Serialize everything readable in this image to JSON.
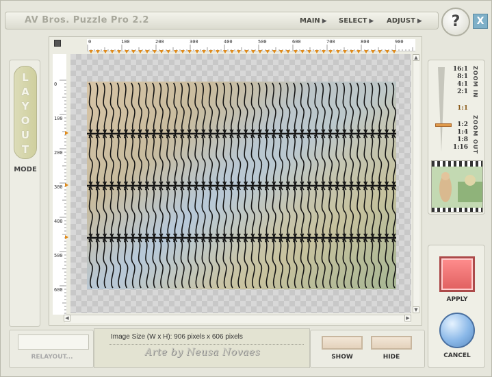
{
  "window": {
    "title": "AV Bros. Puzzle Pro 2.2",
    "help_label": "?",
    "close_label": "X"
  },
  "menu": [
    {
      "label": "MAIN"
    },
    {
      "label": "SELECT"
    },
    {
      "label": "ADJUST"
    }
  ],
  "mode_panel": {
    "letters": [
      "L",
      "A",
      "Y",
      "O",
      "U",
      "T"
    ],
    "mode_label": "MODE"
  },
  "rulers": {
    "top_ticks": [
      "0",
      "100",
      "200",
      "300",
      "400",
      "500",
      "600",
      "700",
      "800",
      "900"
    ],
    "left_ticks": [
      "0",
      "100",
      "200",
      "300",
      "400",
      "500",
      "600"
    ]
  },
  "zoom": {
    "levels_in": [
      "16:1",
      "8:1",
      "4:1",
      "2:1"
    ],
    "current": "1:1",
    "levels_out": [
      "1:2",
      "1:4",
      "1:8",
      "1:16"
    ],
    "zoom_in_label": "ZOOM IN",
    "zoom_out_label": "ZOOM OUT"
  },
  "actions": {
    "apply_label": "APPLY",
    "cancel_label": "CANCEL",
    "show_label": "SHOW",
    "hide_label": "HIDE",
    "relayout_label": "RELAYOUT..."
  },
  "info": {
    "image_size": "Image Size (W x H): 906 pixels x 606 pixels",
    "credit": "Arte by Neusa Novaes"
  },
  "colors": {
    "accent_orange": "#e08a1a",
    "apply_red": "#e06060",
    "cancel_blue": "#8ab8e8",
    "close_blue": "#7fb0c8"
  }
}
